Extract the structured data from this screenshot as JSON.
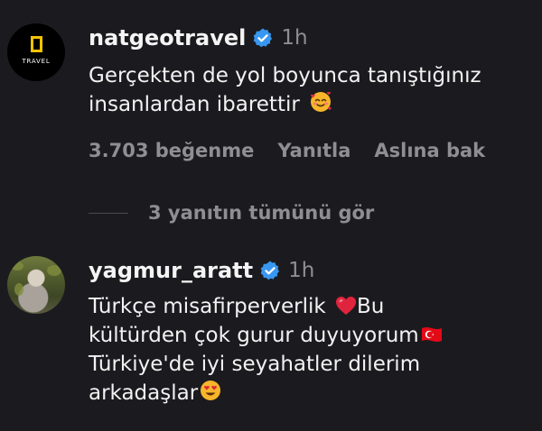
{
  "comments": [
    {
      "username": "natgeotravel",
      "time": "1h",
      "avatar_text": "TRAVEL",
      "lines": [
        "Gerçekten de yol boyunca tanıştığınız",
        "insanlardan ibarettir"
      ],
      "emoji": "smiling-face-with-hearts-icon",
      "actions": {
        "likes": "3.703 beğenme",
        "reply": "Yanıtla",
        "original": "Aslına bak"
      },
      "view_replies": "3 yanıtın tümünü gör"
    },
    {
      "username": "yagmur_aratt",
      "time": "1h",
      "lines": [
        "Türkçe misafirperverlik",
        "Bu",
        "kültürden çok gurur duyuyorum",
        "Türkiye'de iyi seyahatler dilerim",
        "arkadaşlar"
      ]
    }
  ],
  "colors": {
    "background": "#1b1b1f",
    "primary_text": "#f2f2f2",
    "secondary_text": "#8e8e93",
    "verified": "#3897f0",
    "natgeo_yellow": "#f5c400"
  }
}
